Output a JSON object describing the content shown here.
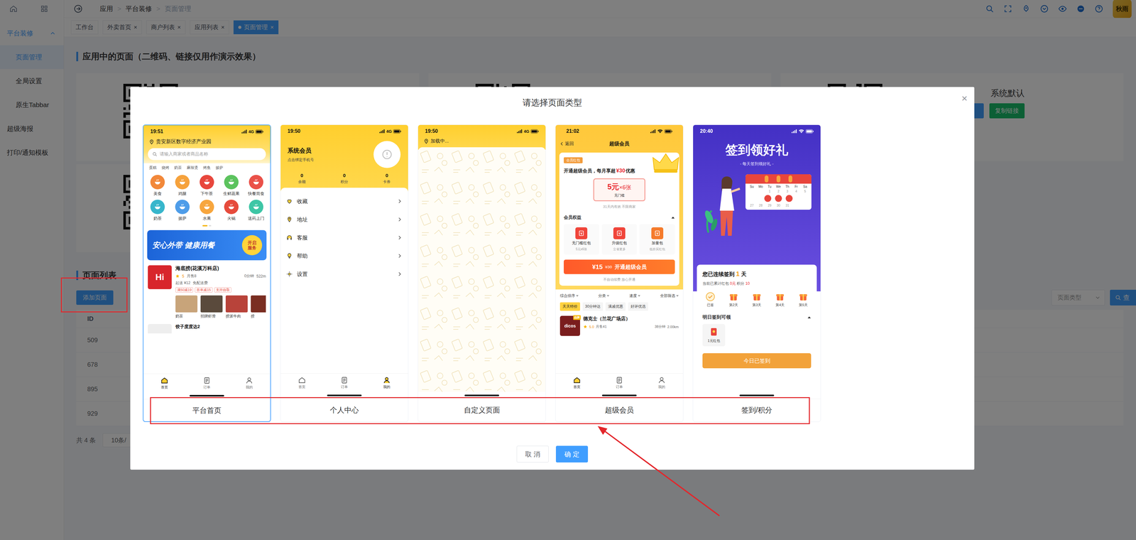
{
  "sidebar": {
    "items": [
      {
        "label": "平台装修",
        "kind": "group",
        "expanded": true,
        "selected": false
      },
      {
        "label": "页面管理",
        "kind": "child",
        "selected": true
      },
      {
        "label": "全局设置",
        "kind": "child",
        "selected": false
      },
      {
        "label": "原生Tabbar",
        "kind": "child",
        "selected": false
      },
      {
        "label": "超级海报",
        "kind": "item",
        "selected": false
      },
      {
        "label": "打印/通知模板",
        "kind": "item",
        "selected": false
      }
    ]
  },
  "topbar": {
    "breadcrumb": [
      "应用",
      "平台装修",
      "页面管理"
    ],
    "separator": ">",
    "avatar": "秋雨"
  },
  "tabs": [
    {
      "label": "工作台",
      "closable": false,
      "selected": false
    },
    {
      "label": "外卖首页",
      "closable": true,
      "selected": false
    },
    {
      "label": "商户列表",
      "closable": true,
      "selected": false
    },
    {
      "label": "应用列表",
      "closable": true,
      "selected": false
    },
    {
      "label": "页面管理",
      "closable": true,
      "selected": true
    }
  ],
  "tab_close": "×",
  "app_pages": {
    "title": "应用中的页面（二维码、链接仅用作演示效果）",
    "cards": [
      {
        "kind": "plain"
      },
      {
        "kind": "plain"
      },
      {
        "kind": "default",
        "label": "系统默认",
        "copy_button": "复制链接"
      },
      {
        "kind": "plain"
      }
    ]
  },
  "page_list": {
    "title": "页面列表",
    "add_button": "添加页面",
    "type_filter": "页面类型",
    "search_button": "查",
    "columns": [
      "ID"
    ],
    "rows": [
      {
        "id": "509"
      },
      {
        "id": "678"
      },
      {
        "id": "895"
      },
      {
        "id": "929"
      }
    ],
    "total": "共 4 条",
    "page_size": "10条/"
  },
  "modal": {
    "title": "请选择页面类型",
    "close": "×",
    "buttons": [
      {
        "label": "取 消",
        "primary": false
      },
      {
        "label": "确 定",
        "primary": true
      }
    ],
    "options": [
      {
        "label": "平台首页",
        "kind": "home",
        "selected": true,
        "screen": {
          "time": "19:51",
          "network": "4G",
          "location": "贵安新区数字经济产业园",
          "search": "请输入商家或者商品名称",
          "hot_words": [
            "蛋糕",
            "烧烤",
            "奶茶",
            "麻辣烫",
            "烤鱼",
            "披萨"
          ],
          "categories": [
            {
              "label": "美食",
              "color": "#f2883a"
            },
            {
              "label": "鸡腿",
              "color": "#f6a23c"
            },
            {
              "label": "下午茶",
              "color": "#e8473d"
            },
            {
              "label": "生鲜蔬果",
              "color": "#5cc35e"
            },
            {
              "label": "快餐简食",
              "color": "#ea5149"
            },
            {
              "label": "奶茶",
              "color": "#38b6cc"
            },
            {
              "label": "披萨",
              "color": "#4e9de9"
            },
            {
              "label": "水果",
              "color": "#f7a63e"
            },
            {
              "label": "火锅",
              "color": "#e64b3c"
            },
            {
              "label": "送药上门",
              "color": "#3ec6a6"
            }
          ],
          "pager": [
            {
              "selected": true
            },
            {
              "selected": false
            }
          ],
          "banner": {
            "title": "安心外带 健康用餐",
            "button": "开启服务"
          },
          "store": {
            "logo": "Hi",
            "name": "海底捞(花溪万科店)",
            "rating": "5",
            "sales": "月售8",
            "time": "0分钟",
            "distance": "522m",
            "min_order": "起送 ¥12",
            "delivery": "免配送费",
            "tags": [
              "满50减19",
              "首单减15",
              "支持自取"
            ],
            "items": [
              "奶茶",
              "招牌虾滑",
              "捞派牛肉",
              "捞"
            ]
          },
          "next_store": "饺子度度达2",
          "tabbar": [
            {
              "label": "首页",
              "selected": true
            },
            {
              "label": "订单",
              "selected": false
            },
            {
              "label": "我的",
              "selected": false
            }
          ]
        }
      },
      {
        "label": "个人中心",
        "kind": "profile",
        "selected": false,
        "screen": {
          "time": "19:50",
          "network": "4G",
          "name": "系统会员",
          "subtitle": "点击绑定手机号",
          "stats": [
            {
              "value": "0",
              "label": "余额"
            },
            {
              "value": "0",
              "label": "积分"
            },
            {
              "value": "0",
              "label": "卡券"
            }
          ],
          "menu": [
            "收藏",
            "地址",
            "客服",
            "帮助",
            "设置"
          ],
          "tabbar": [
            {
              "label": "首页",
              "selected": false
            },
            {
              "label": "订单",
              "selected": false
            },
            {
              "label": "我的",
              "selected": true
            }
          ]
        }
      },
      {
        "label": "自定义页面",
        "kind": "custom",
        "selected": false,
        "screen": {
          "time": "19:50",
          "network": "4G",
          "title": "加载中..."
        }
      },
      {
        "label": "超级会员",
        "kind": "vip",
        "selected": false,
        "screen": {
          "time": "21:02",
          "back": "返回",
          "title": "超级会员",
          "badge": "会员红包",
          "headline": "开通超级会员，每月享超",
          "headline_amount": "¥30",
          "headline_suffix": "优惠",
          "coupon": {
            "amount": "5元",
            "count": "×6张",
            "note": "无门槛"
          },
          "coupon_note": "31天内有效 不限商家",
          "rights_title": "会员权益",
          "rights": [
            {
              "title": "无门槛红包",
              "sub": "5元x6张",
              "color": "#f0453a"
            },
            {
              "title": "升级红包",
              "sub": "立省更多",
              "color": "#f0453a"
            },
            {
              "title": "加量包",
              "sub": "低价买红包",
              "color": "#f57b2c"
            }
          ],
          "cta": {
            "price": "¥15",
            "old_price": "¥30",
            "label": "开通超级会员"
          },
          "cta_note": "不自动续费 放心开通",
          "sorts": [
            "综合排序",
            "分类",
            "速度",
            "全部筛选"
          ],
          "chips": [
            {
              "label": "天天特价",
              "selected": true
            },
            {
              "label": "30分钟达",
              "selected": false
            },
            {
              "label": "满减优惠",
              "selected": false
            },
            {
              "label": "好评优选",
              "selected": false
            }
          ],
          "store": {
            "logo": "dicos",
            "tag": "品牌",
            "name": "德克士（兰花广场店）",
            "rating": "5.0",
            "sales": "月售41",
            "time": "38分钟",
            "distance": "2.00km"
          },
          "tabbar": [
            {
              "label": "首页",
              "selected": true
            },
            {
              "label": "订单",
              "selected": false
            },
            {
              "label": "我的",
              "selected": false
            }
          ]
        }
      },
      {
        "label": "签到/积分",
        "kind": "signin",
        "selected": false,
        "screen": {
          "time": "20:40",
          "title": "签到领好礼",
          "subtitle": "- 每天签到领好礼 -",
          "weekdays": [
            "Su",
            "Mo",
            "Tu",
            "We",
            "Th",
            "Fr",
            "Sa"
          ],
          "date_rows": [
            [
              "1",
              "2",
              "3",
              "4",
              "5"
            ],
            [
              "27",
              "28",
              "29",
              "30",
              "31"
            ]
          ],
          "streak": {
            "prefix": "您已连续签到",
            "days": "1",
            "suffix": "天"
          },
          "summary": {
            "prefix": "当前已累计红包",
            "amount": "0元",
            "points_label": "积分",
            "points": "10"
          },
          "days": [
            {
              "label": "已签",
              "signed": true
            },
            {
              "label": "第2天",
              "signed": false
            },
            {
              "label": "第3天",
              "signed": false
            },
            {
              "label": "第4天",
              "signed": false
            },
            {
              "label": "第5天",
              "signed": false
            }
          ],
          "tomorrow": "明日签到可领",
          "reward": "1元红包",
          "button": "今日已签到"
        }
      }
    ]
  }
}
